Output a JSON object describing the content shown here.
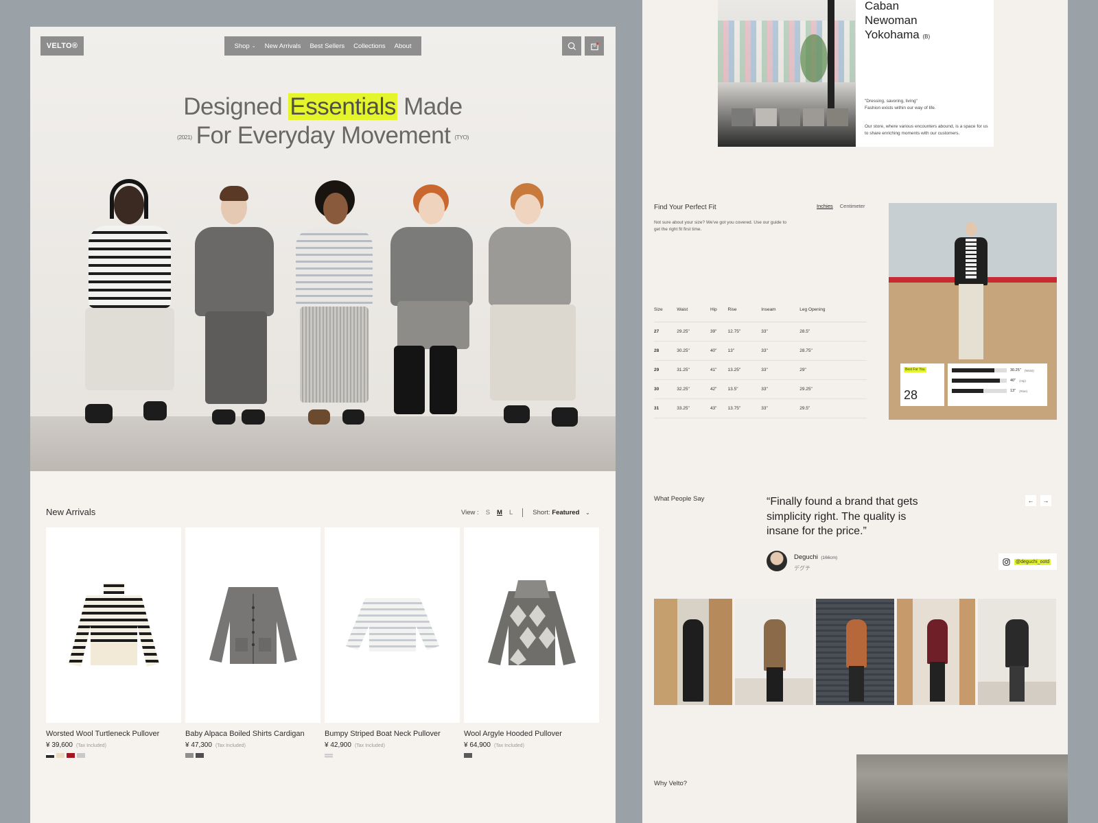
{
  "brand": {
    "logo": "VELTO®"
  },
  "nav": {
    "items": [
      "Shop",
      "New Arrivals",
      "Best Sellers",
      "Collections",
      "About"
    ]
  },
  "icons": {
    "search": "search-icon",
    "cart": "bag-icon"
  },
  "hero": {
    "line1_pre": "Designed ",
    "line1_highlight": "Essentials",
    "line1_post": " Made",
    "line2": "For Everyday Movement",
    "tag_left": "(2021)",
    "tag_right": "(TYO)",
    "highlight_color": "#e5f52c"
  },
  "new_arrivals": {
    "title": "New Arrivals",
    "view_label": "View :",
    "sizes": [
      "S",
      "M",
      "L"
    ],
    "active_size": "M",
    "sort_label": "Short:",
    "sort_value": "Featured",
    "tax_note": "(Tax Included)",
    "products": [
      {
        "name": "Worsted Wool Turtleneck Pullover",
        "price": "¥ 39,600",
        "swatches": [
          "#2a2a2a",
          "#e9dcc0",
          "#a4161f",
          "#c9c9c9"
        ]
      },
      {
        "name": "Baby Alpaca Boiled Shirts Cardigan",
        "price": "¥ 47,300",
        "swatches": [
          "#8f8f8f",
          "#4f4f4f"
        ]
      },
      {
        "name": "Bumpy Striped Boat Neck Pullover",
        "price": "¥ 42,900",
        "swatches": [
          "#dcdcdc"
        ]
      },
      {
        "name": "Wool Argyle Hooded Pullover",
        "price": "¥ 64,900",
        "swatches": [
          "#5a5a5a"
        ]
      }
    ]
  },
  "store": {
    "name_lines": [
      "Caban",
      "Newoman",
      "Yokohama"
    ],
    "name_tag": "(B)",
    "quote_line1": "\"Dressing, savoring, living\"",
    "quote_line2": "Fashion exists within our way of life.",
    "description": "Our store, where various encounters abound, is a space for us to share enriching moments with our customers."
  },
  "fit": {
    "title": "Find Your Perfect Fit",
    "subtitle": "Not sure about your size? We've got you covered. Use our guide to get the right fit first time.",
    "units": [
      "Inchies",
      "Centimeter"
    ],
    "active_unit": "Inchies",
    "headers": [
      "Size",
      "Waist",
      "Hip",
      "Rise",
      "Inseam",
      "Leg Opening"
    ],
    "rows": [
      [
        "27",
        "29.25\"",
        "39\"",
        "12.75\"",
        "33\"",
        "28.5\""
      ],
      [
        "28",
        "30.25\"",
        "40\"",
        "13\"",
        "33\"",
        "28.75\""
      ],
      [
        "29",
        "31.25\"",
        "41\"",
        "13.25\"",
        "33\"",
        "29\""
      ],
      [
        "30",
        "32.25\"",
        "42\"",
        "13.5\"",
        "33\"",
        "29.25\""
      ],
      [
        "31",
        "33.25\"",
        "43\"",
        "13.75\"",
        "33\"",
        "29.5\""
      ]
    ],
    "card": {
      "badge": "Best For You",
      "size": "28",
      "measures": [
        {
          "value": "30.25\"",
          "label": "(Waist)",
          "fill": 0.78
        },
        {
          "value": "40\"",
          "label": "(Hip)",
          "fill": 0.88
        },
        {
          "value": "13\"",
          "label": "(Rise)",
          "fill": 0.58
        }
      ]
    }
  },
  "testimonials": {
    "title": "What People Say",
    "quote": "“Finally found a brand that gets simplicity right. The quality is insane for the price.”",
    "author": "Deguchi",
    "author_height": "(166cm)",
    "author_jp": "デグチ",
    "handle": "@deguchi_ootd",
    "prev": "←",
    "next": "→"
  },
  "why": {
    "title": "Why Velto?"
  }
}
